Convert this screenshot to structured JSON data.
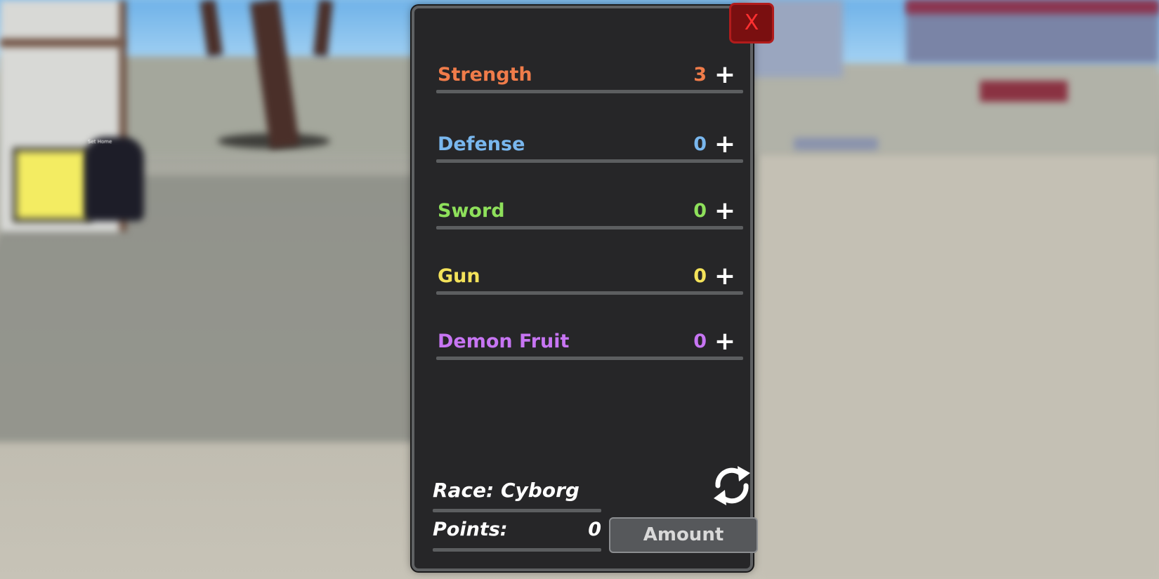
{
  "close_button": {
    "label": "X"
  },
  "stats": [
    {
      "label": "Strength",
      "value": "3",
      "plus": "+",
      "color": "#f07c4a"
    },
    {
      "label": "Defense",
      "value": "0",
      "plus": "+",
      "color": "#79b7ee"
    },
    {
      "label": "Sword",
      "value": "0",
      "plus": "+",
      "color": "#8ee05b"
    },
    {
      "label": "Gun",
      "value": "0",
      "plus": "+",
      "color": "#f3e25a"
    },
    {
      "label": "Demon Fruit",
      "value": "0",
      "plus": "+",
      "color": "#c775f3"
    }
  ],
  "footer": {
    "race": "Race: Cyborg",
    "points_label": "Points:",
    "points_value": "0",
    "amount_placeholder": "Amount",
    "refresh_icon": "refresh-icon"
  },
  "background_text": {
    "sign": "Set Home"
  }
}
